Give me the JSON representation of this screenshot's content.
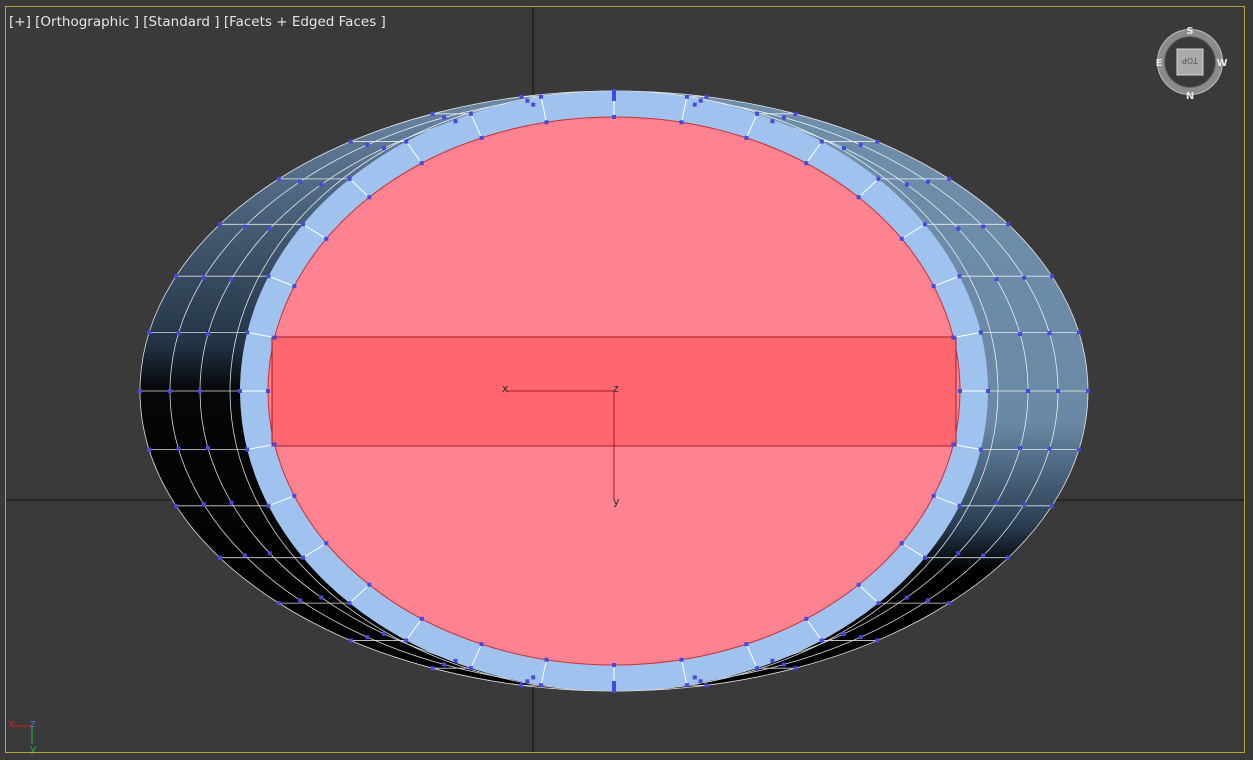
{
  "viewport": {
    "menu_label": "[+]",
    "view_label": "[Orthographic ]",
    "shading_label": "[Standard ]",
    "display_label": "[Facets + Edged Faces ]"
  },
  "viewcube": {
    "face": "TOP",
    "north": "N",
    "south": "S",
    "east": "E",
    "west": "W"
  },
  "gizmo": {
    "x_label": "x",
    "y_label": "y",
    "z_label": "z"
  },
  "corner_axes": {
    "x_label": "x",
    "y_label": "y",
    "z_label": "z"
  },
  "colors": {
    "background": "#3a3a3a",
    "frame": "#b8a33a",
    "selected_face": "#ff8290",
    "selected_band": "#ff666d",
    "ring": "#9fc3ee",
    "vertex": "#4848e0"
  }
}
